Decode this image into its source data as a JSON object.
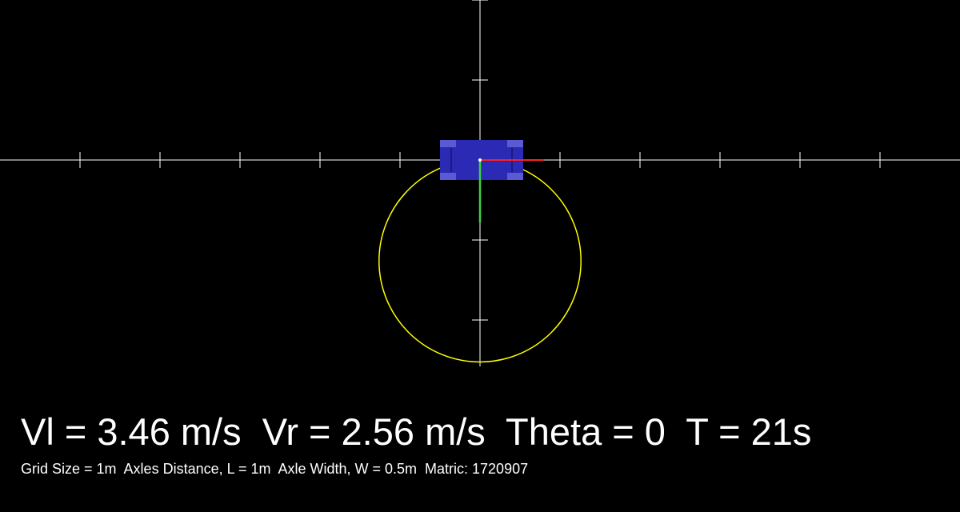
{
  "status": {
    "line": "Vl = 3.46 m/s  Vr = 2.56 m/s  Theta = 0  T = 21s"
  },
  "info": {
    "line": "Grid Size = 1m  Axles Distance, L = 1m  Axle Width, W = 0.5m  Matric: 1720907"
  },
  "scene": {
    "grid_size_m": 1,
    "axle_distance_m": 1,
    "axle_width_m": 0.5,
    "theta": 0,
    "vl_mps": 3.46,
    "vr_mps": 2.56,
    "time_s": 21
  },
  "colors": {
    "background": "#000000",
    "axis": "#ffffff",
    "trajectory": "#ffff00",
    "robot_body": "#2a2ab4",
    "robot_wheel": "#5a5ad2",
    "heading_x": "#ff2020",
    "heading_y": "#40d040",
    "text": "#ffffff"
  }
}
